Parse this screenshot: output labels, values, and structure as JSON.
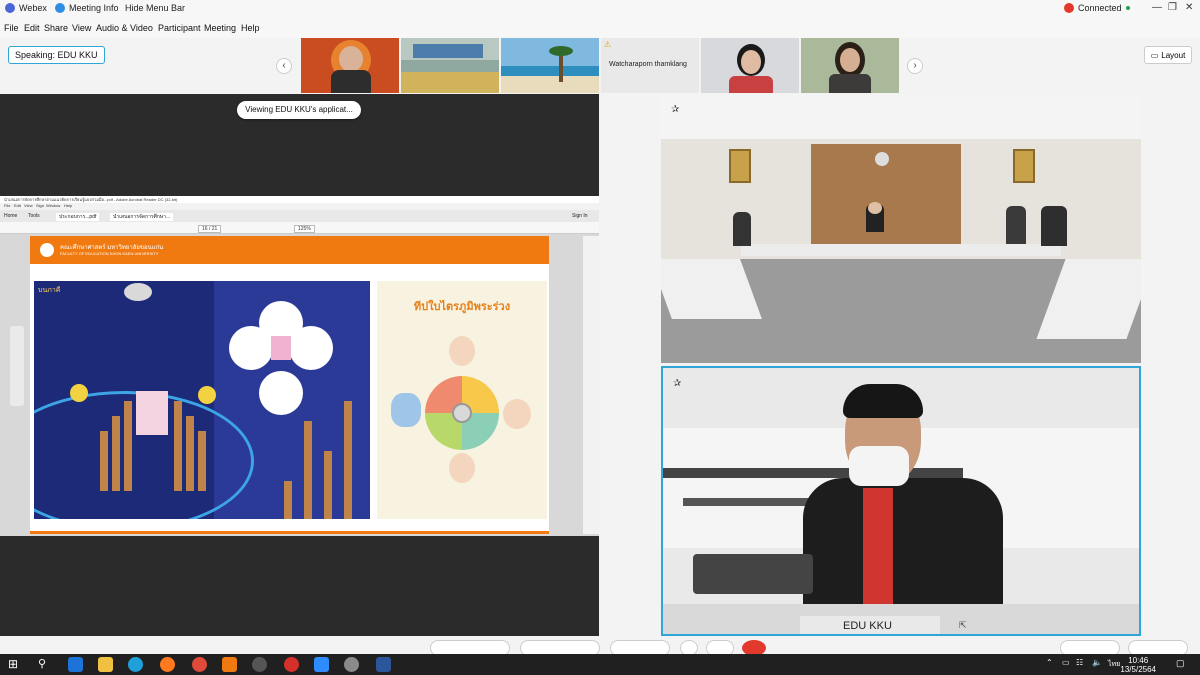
{
  "titlebar": {
    "app_name": "Webex",
    "meeting_info": "Meeting Info",
    "hide_menu": "Hide Menu Bar",
    "status": "Connected"
  },
  "menu": [
    "File",
    "Edit",
    "Share",
    "View",
    "Audio & Video",
    "Participant",
    "Meeting",
    "Help"
  ],
  "speaking": {
    "label": "Speaking: EDU KKU"
  },
  "thumbnails": {
    "named_participant": "Watcharaporn thamklang"
  },
  "layout_button": "Layout",
  "share": {
    "viewing_label": "Viewing EDU KKU's applicat...",
    "acrobat_title": "นำเสนอการจัดการศึกษาตามแนวคิดการเรียนรู้แบบร่วมมือ...pdf - Adobe Acrobat Reader DC (32-bit)",
    "acrobat_menu": [
      "File",
      "Edit",
      "View",
      "Sign",
      "Window",
      "Help"
    ],
    "tabs": [
      "Home",
      "Tools",
      "ประกอบการ...pdf",
      "นำเสนอการจัดการศึกษา..."
    ],
    "signin": "Sign In",
    "page_indicator": "16 / 21",
    "zoom": "125%",
    "slide_header": "คณะศึกษาศาสตร์ มหาวิทยาลัยขอนแก่น",
    "slide_subheader": "FACULTY OF EDUCATION KHON KAEN UNIVERSITY",
    "poster_title": "ทีปใบไตรภูมิพระร่วง",
    "left_poster_label": "บนภาคี"
  },
  "video": {
    "main_speaker_name": "EDU KKU"
  },
  "taskbar": {
    "time": "10:46",
    "date": "13/5/2564",
    "lang": "ไทย"
  },
  "colors": {
    "accent": "#2fa5d8",
    "connected": "#22a35a",
    "slide_orange": "#f07a10"
  }
}
